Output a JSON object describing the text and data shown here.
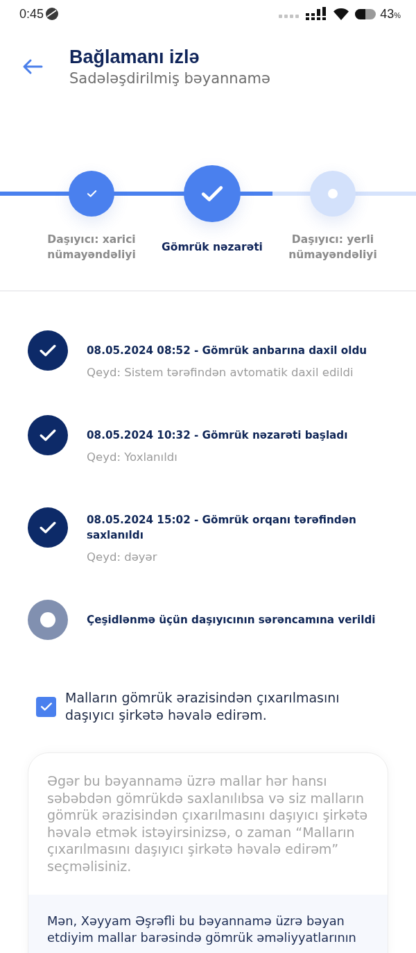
{
  "status_bar": {
    "time": "0:45",
    "battery_percent": "43",
    "battery_unit": "%"
  },
  "header": {
    "title": "Bağlamanı izlə",
    "subtitle": "Sadələşdirilmiş bəyannamə"
  },
  "steps": [
    {
      "label": "Daşıyıcı: xarici nümayəndəliyi",
      "completed": true,
      "selected": false
    },
    {
      "label": "Gömrük nəzarəti",
      "completed": true,
      "selected": true
    },
    {
      "label": "Daşıyıcı: yerli nümayəndəliyi",
      "completed": false,
      "selected": false
    }
  ],
  "events": [
    {
      "title": "08.05.2024 08:52 - Gömrük anbarına daxil oldu",
      "note": "Qeyd: Sistem tərəfindən avtomatik daxil edildi",
      "completed": true
    },
    {
      "title": "08.05.2024 10:32 - Gömrük nəzarəti başladı",
      "note": "Qeyd: Yoxlanıldı",
      "completed": true
    },
    {
      "title": "08.05.2024 15:02 - Gömrük orqanı tərəfindən saxlanıldı",
      "note": "Qeyd: dəyər",
      "completed": true
    },
    {
      "title": "Çeşidlənmə üçün daşıyıcının sərəncamına verildi",
      "completed": false
    }
  ],
  "delegate_checkbox": {
    "label": "Malların gömrük ərazisindən çıxarılmasını daşıyıcı şirkətə həvalə edirəm.",
    "checked": true
  },
  "info_card": {
    "text": "Əgər bu bəyannamə üzrə mallar hər hansı səbəbdən gömrükdə saxlanılıbsa və siz malların gömrük ərazisindən çıxarılmasını daşıyıcı şirkətə həvalə etmək istəyirsinizsə, o zaman “Malların çıxarılmasını daşıyıcı şirkətə həvalə edirəm” seçməlisiniz.",
    "consent_text": "Mən, Xəyyam Əşrəfli bu bəyannamə üzrə bəyan etdiyim mallar barəsində gömrük əməliyyatlarının"
  }
}
